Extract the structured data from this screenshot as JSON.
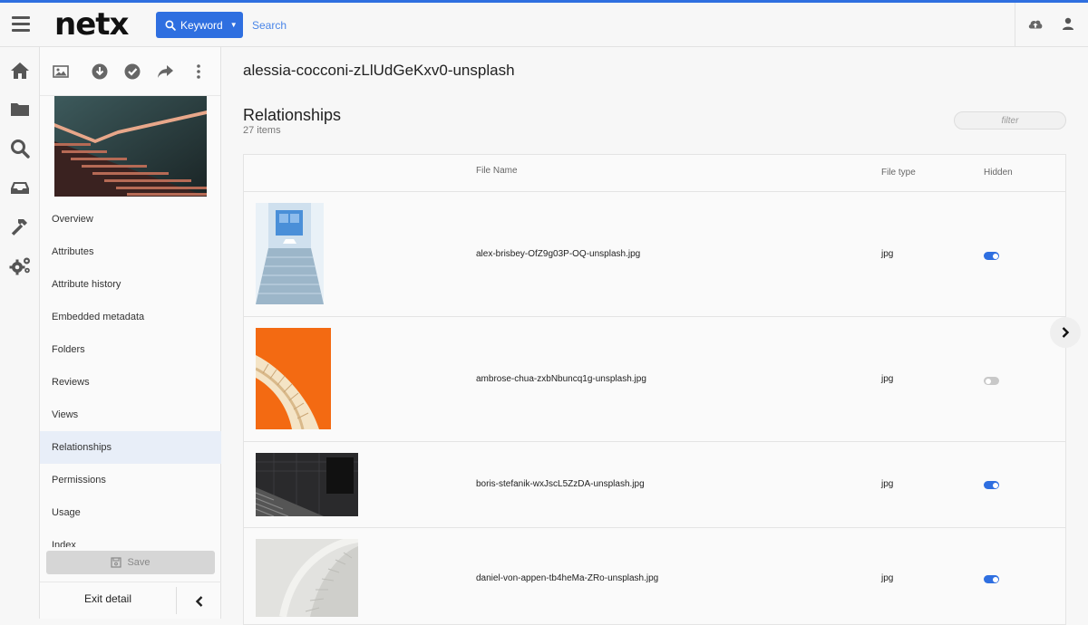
{
  "topbar": {
    "logo": "netx",
    "search_mode": "Keyword",
    "search_placeholder": "Search"
  },
  "leftnav": {
    "items": [
      {
        "icon": "home-icon"
      },
      {
        "icon": "folder-icon"
      },
      {
        "icon": "search-icon"
      },
      {
        "icon": "inbox-icon"
      },
      {
        "icon": "hammer-icon"
      },
      {
        "icon": "settings-icon"
      }
    ]
  },
  "panel": {
    "menu": [
      {
        "label": "Overview"
      },
      {
        "label": "Attributes"
      },
      {
        "label": "Attribute history"
      },
      {
        "label": "Embedded metadata"
      },
      {
        "label": "Folders"
      },
      {
        "label": "Reviews"
      },
      {
        "label": "Views"
      },
      {
        "label": "Relationships",
        "active": true
      },
      {
        "label": "Permissions"
      },
      {
        "label": "Usage"
      },
      {
        "label": "Index"
      }
    ],
    "save_label": "Save",
    "exit_label": "Exit detail"
  },
  "main": {
    "asset_title": "alessia-cocconi-zLlUdGeKxv0-unsplash",
    "section_title": "Relationships",
    "item_count": "27 items",
    "filter_placeholder": "filter",
    "table": {
      "headers": {
        "file_name": "File Name",
        "file_type": "File type",
        "hidden": "Hidden"
      },
      "rows": [
        {
          "file_name": "alex-brisbey-OfZ9g03P-OQ-unsplash.jpg",
          "file_type": "jpg",
          "hidden": true
        },
        {
          "file_name": "ambrose-chua-zxbNbuncq1g-unsplash.jpg",
          "file_type": "jpg",
          "hidden": false
        },
        {
          "file_name": "boris-stefanik-wxJscL5ZzDA-unsplash.jpg",
          "file_type": "jpg",
          "hidden": true
        },
        {
          "file_name": "daniel-von-appen-tb4heMa-ZRo-unsplash.jpg",
          "file_type": "jpg",
          "hidden": true
        }
      ]
    }
  },
  "colors": {
    "accent": "#2f6fe0",
    "active_menu_bg": "#e8eef8",
    "toggle_off": "#c8c8c8"
  }
}
